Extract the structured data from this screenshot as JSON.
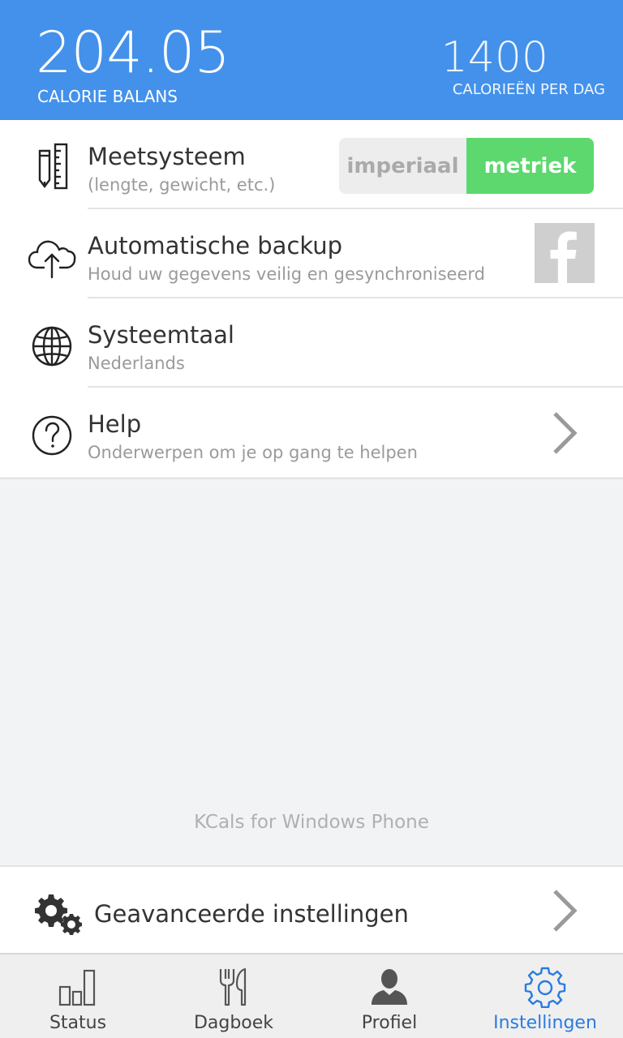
{
  "header": {
    "calorie_balance": "204.05",
    "calorie_balance_label": "CALORIE BALANS",
    "calories_per_day": "1400",
    "calories_per_day_label": "CALORIEËN PER DAG",
    "color": "#4391ea"
  },
  "settings": {
    "measurement": {
      "title": "Meetsysteem",
      "subtitle": "(lengte, gewicht, etc.)",
      "option_imperial": "imperiaal",
      "option_metric": "metriek",
      "selected": "metriek",
      "icon": "ruler-pencil-icon"
    },
    "backup": {
      "title": "Automatische backup",
      "subtitle": "Houd uw gegevens veilig en gesynchroniseerd",
      "icon": "cloud-upload-icon",
      "action_icon": "facebook-icon"
    },
    "language": {
      "title": "Systeemtaal",
      "subtitle": "Nederlands",
      "icon": "globe-icon"
    },
    "help": {
      "title": "Help",
      "subtitle": "Onderwerpen om je op gang te helpen",
      "icon": "question-circle-icon"
    }
  },
  "footer_text": "KCals for Windows Phone",
  "advanced": {
    "title": "Geavanceerde instellingen",
    "icon": "gears-icon"
  },
  "nav": {
    "status": "Status",
    "diary": "Dagboek",
    "profile": "Profiel",
    "settings": "Instellingen",
    "active": "Instellingen",
    "active_color": "#2a7be0"
  },
  "colors": {
    "toggle_on": "#5cd86f",
    "toggle_off": "#ededed"
  }
}
